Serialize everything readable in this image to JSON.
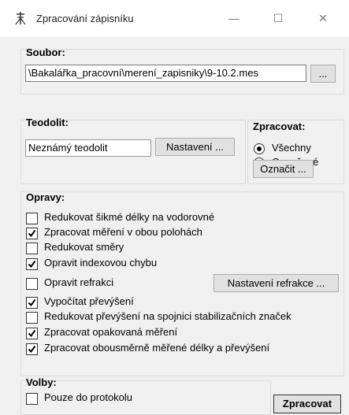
{
  "window": {
    "title": "Zpracování zápisníku"
  },
  "titlebar_buttons": {
    "minimize": "—",
    "maximize": "☐",
    "close": "✕"
  },
  "soubor": {
    "title": "Soubor:",
    "path": "\\Bakalářka_pracovní\\merení_zapisniky\\9-10.2.mes",
    "browse_label": "..."
  },
  "teodolit": {
    "title": "Teodolit:",
    "value": "Neznámý teodolit",
    "settings_label": "Nastavení ..."
  },
  "zpracovat": {
    "title": "Zpracovat:",
    "options": [
      "Všechny",
      "Označené"
    ],
    "selected": "Všechny",
    "mark_label": "Označit ..."
  },
  "opravy": {
    "title": "Opravy:",
    "items": [
      {
        "label": "Redukovat šikmé délky na vodorovné",
        "checked": false
      },
      {
        "label": "Zpracovat měření v obou polohách",
        "checked": true
      },
      {
        "label": "Redukovat směry",
        "checked": false
      },
      {
        "label": "Opravit indexovou chybu",
        "checked": true
      },
      {
        "label": "Opravit refrakci",
        "checked": false
      },
      {
        "label": "Vypočítat převýšení",
        "checked": true
      },
      {
        "label": "Redukovat převýšení na spojnici stabilizačních značek",
        "checked": false
      },
      {
        "label": "Zpracovat opakovaná měření",
        "checked": true
      },
      {
        "label": "Zpracovat obousměrně měřené délky a převýšení",
        "checked": true
      }
    ],
    "refraction_settings_label": "Nastavení refrakce ..."
  },
  "volby": {
    "title": "Volby:",
    "items": [
      {
        "label": "Pouze do protokolu",
        "checked": false
      }
    ]
  },
  "actions": {
    "process_label": "Zpracovat"
  }
}
